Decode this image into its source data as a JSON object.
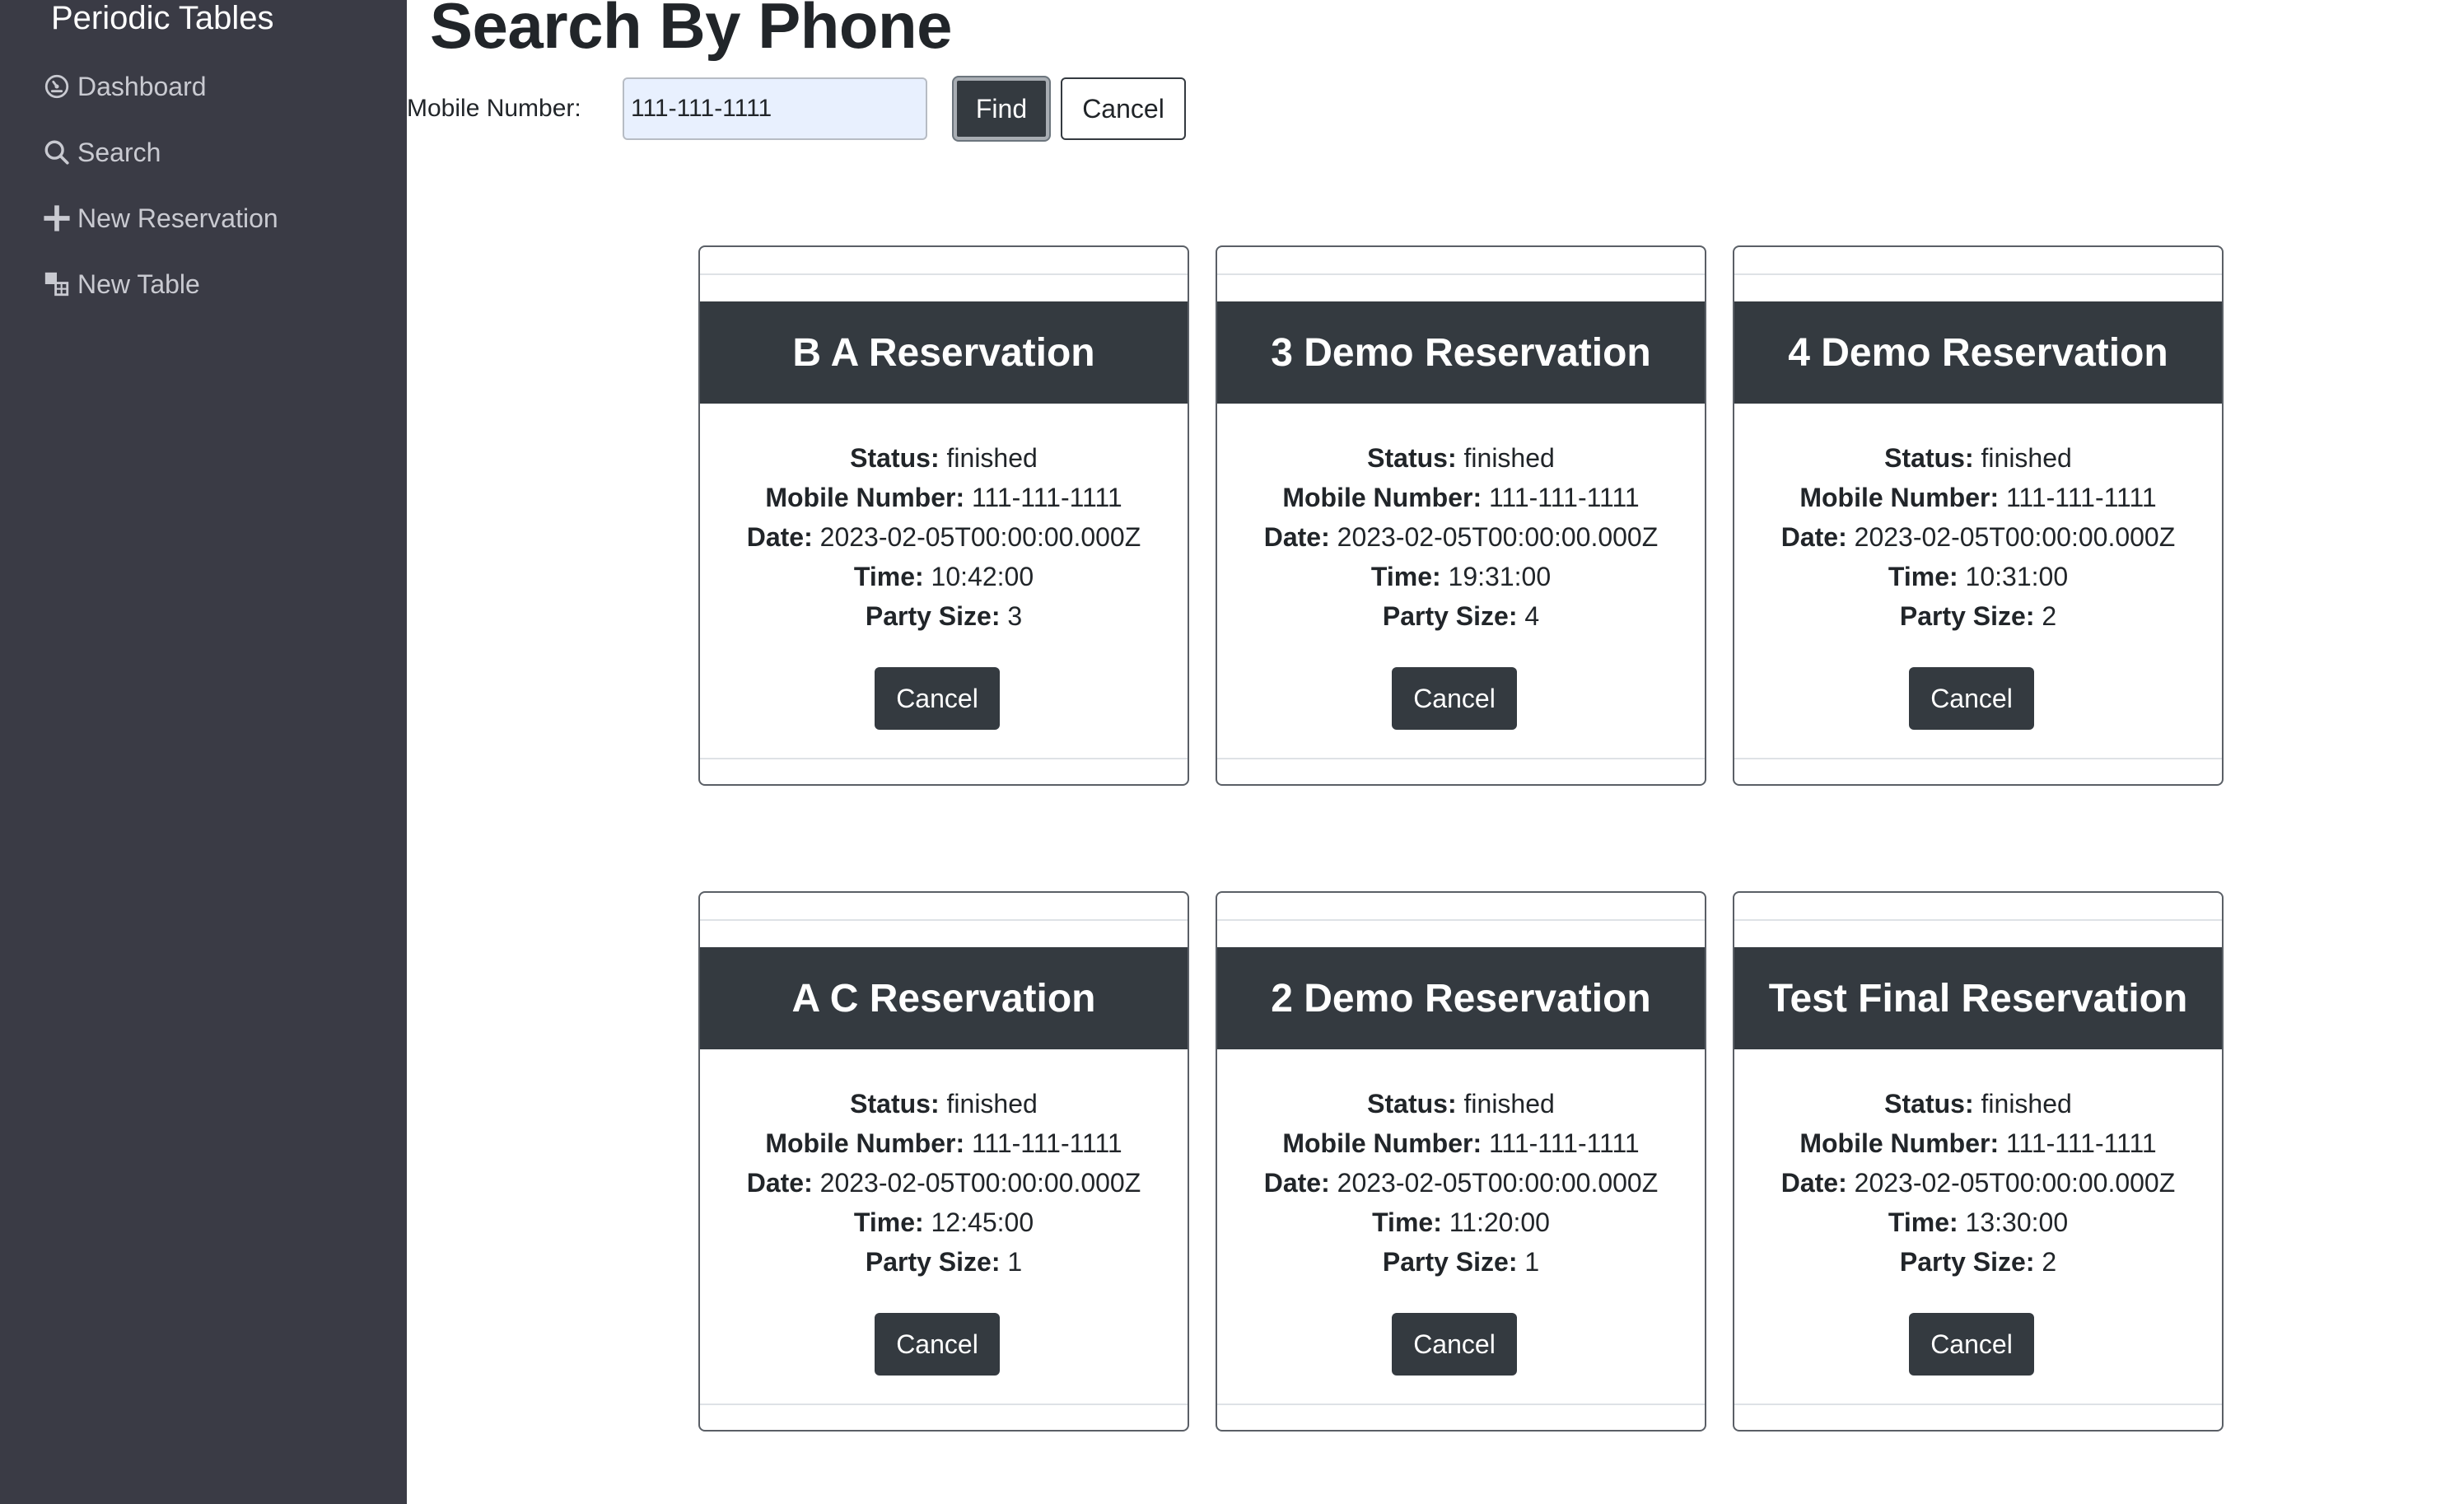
{
  "sidebar": {
    "brand": "Periodic Tables",
    "items": [
      {
        "label": "Dashboard",
        "icon": "dashboard-icon"
      },
      {
        "label": "Search",
        "icon": "search-icon"
      },
      {
        "label": "New Reservation",
        "icon": "plus-icon"
      },
      {
        "label": "New Table",
        "icon": "table-icon"
      }
    ]
  },
  "page": {
    "title": "Search By Phone",
    "mobile_label": "Mobile Number:",
    "mobile_value": "111-111-1111",
    "find_label": "Find",
    "cancel_label": "Cancel"
  },
  "field_labels": {
    "status": "Status:",
    "mobile": "Mobile Number:",
    "date": "Date:",
    "time": "Time:",
    "party_size": "Party Size:"
  },
  "reservations": [
    {
      "name": "B A Reservation",
      "status": "finished",
      "mobile": "111-111-1111",
      "date": "2023-02-05T00:00:00.000Z",
      "time": "10:42:00",
      "party_size": "3",
      "cancel": "Cancel"
    },
    {
      "name": "3 Demo Reservation",
      "status": "finished",
      "mobile": "111-111-1111",
      "date": "2023-02-05T00:00:00.000Z",
      "time": "19:31:00",
      "party_size": "4",
      "cancel": "Cancel"
    },
    {
      "name": "4 Demo Reservation",
      "status": "finished",
      "mobile": "111-111-1111",
      "date": "2023-02-05T00:00:00.000Z",
      "time": "10:31:00",
      "party_size": "2",
      "cancel": "Cancel"
    },
    {
      "name": "A C Reservation",
      "status": "finished",
      "mobile": "111-111-1111",
      "date": "2023-02-05T00:00:00.000Z",
      "time": "12:45:00",
      "party_size": "1",
      "cancel": "Cancel"
    },
    {
      "name": "2 Demo Reservation",
      "status": "finished",
      "mobile": "111-111-1111",
      "date": "2023-02-05T00:00:00.000Z",
      "time": "11:20:00",
      "party_size": "1",
      "cancel": "Cancel"
    },
    {
      "name": "Test Final Reservation",
      "status": "finished",
      "mobile": "111-111-1111",
      "date": "2023-02-05T00:00:00.000Z",
      "time": "13:30:00",
      "party_size": "2",
      "cancel": "Cancel"
    }
  ],
  "colors": {
    "sidebar": "#3a3b45",
    "card_header": "#343a40",
    "input_bg": "#e8f0fe"
  }
}
